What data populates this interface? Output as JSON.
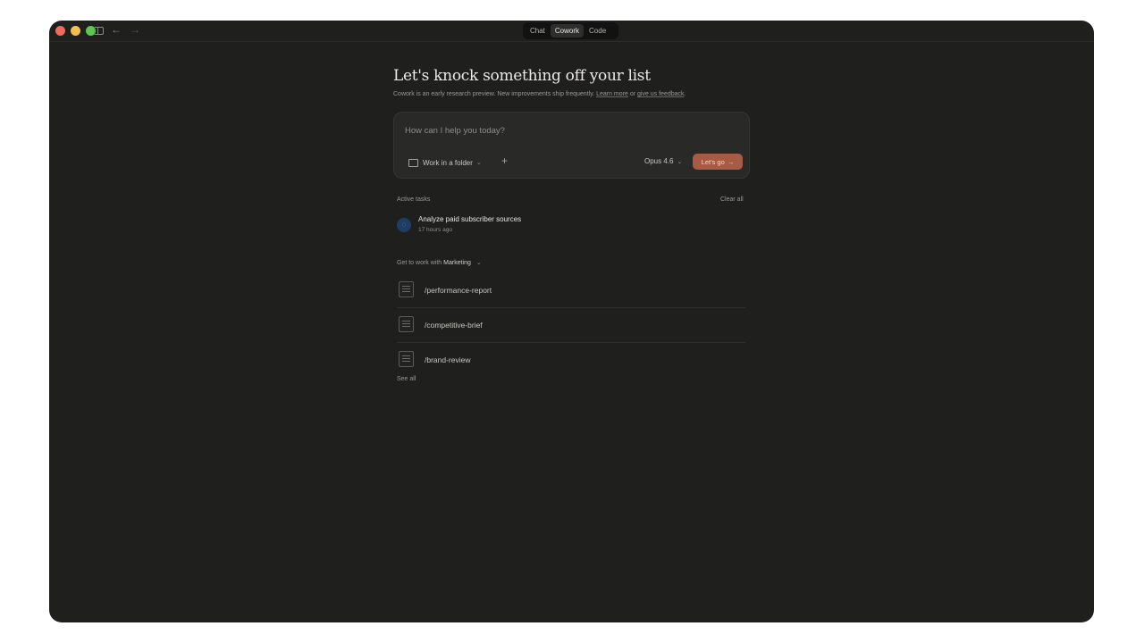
{
  "nav": {
    "back_icon": "←",
    "forward_icon": "→"
  },
  "mode_tabs": [
    {
      "label": "Chat"
    },
    {
      "label": "Cowork",
      "active": true
    },
    {
      "label": "Code"
    }
  ],
  "header": {
    "title": "Let's knock something off your list",
    "subtitle_pre": "Cowork is an early research preview. New improvements ship frequently. ",
    "learn_more": "Learn more",
    "subtitle_mid": " or ",
    "feedback": "give us feedback",
    "subtitle_end": "."
  },
  "prompt": {
    "placeholder": "How can I help you today?",
    "value": "",
    "folder_label": "Work in a folder",
    "plus": "+",
    "model": "Opus 4.6",
    "go_label": "Let's go",
    "go_arrow": "→",
    "accent_color": "#a85b44"
  },
  "active_tasks": {
    "label": "Active tasks",
    "clear_label": "Clear all",
    "items": [
      {
        "title": "Analyze paid subscriber sources",
        "time": "17 hours ago"
      }
    ]
  },
  "work_with": {
    "prefix": "Get to work with ",
    "dept": "Marketing",
    "commands": [
      {
        "label": "/performance-report"
      },
      {
        "label": "/competitive-brief"
      },
      {
        "label": "/brand-review"
      }
    ],
    "see_all": "See all"
  }
}
